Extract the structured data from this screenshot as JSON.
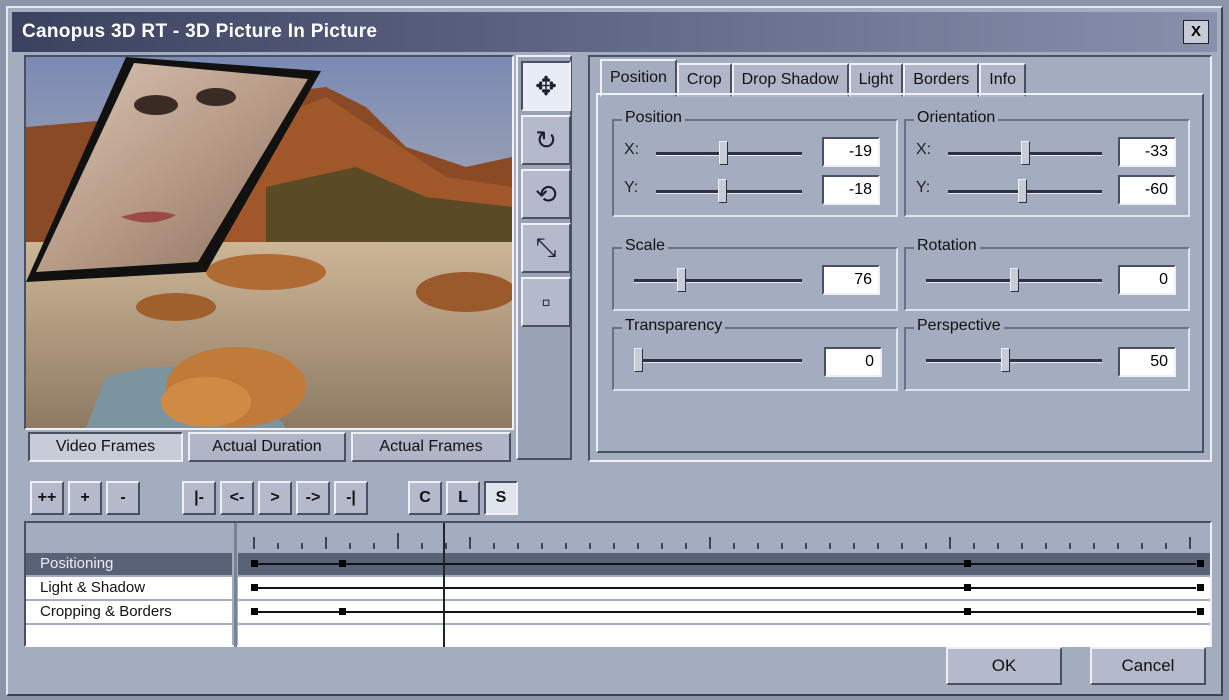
{
  "window": {
    "title": "Canopus 3D RT - 3D Picture In Picture",
    "close_label": "X"
  },
  "tools": [
    {
      "icon": "move-arrows-icon",
      "glyph": "✥"
    },
    {
      "icon": "rotate-3d-icon",
      "glyph": "↻"
    },
    {
      "icon": "rotate-2d-icon",
      "glyph": "⟲"
    },
    {
      "icon": "scale-icon",
      "glyph": "⤡"
    },
    {
      "icon": "blank-square-icon",
      "glyph": "▫"
    }
  ],
  "frame_modes": [
    "Video Frames",
    "Actual Duration",
    "Actual Frames"
  ],
  "tabs": [
    "Position",
    "Crop",
    "Drop Shadow",
    "Light",
    "Borders",
    "Info"
  ],
  "groups": {
    "position": {
      "label": "Position",
      "x_label": "X:",
      "y_label": "Y:",
      "x_value": "-19",
      "y_value": "-18",
      "x_level": 0.46,
      "y_level": 0.45
    },
    "orientation": {
      "label": "Orientation",
      "x_label": "X:",
      "y_label": "Y:",
      "x_value": "-33",
      "y_value": "-60",
      "x_level": 0.5,
      "y_level": 0.48
    },
    "scale": {
      "label": "Scale",
      "value": "76",
      "level": 0.27
    },
    "rotation": {
      "label": "Rotation",
      "value": "0",
      "level": 0.5
    },
    "transparency": {
      "label": "Transparency",
      "value": "0",
      "level": 0.0
    },
    "perspective": {
      "label": "Perspective",
      "value": "50",
      "level": 0.45
    }
  },
  "keyframe_toolbar": [
    "++",
    "+",
    "-"
  ],
  "transport": [
    "|-",
    "<-",
    ">",
    "->",
    "-|"
  ],
  "copy_buttons": [
    "C",
    "L",
    "S"
  ],
  "tracks": [
    {
      "label": "Positioning",
      "keyframes": [
        0.0,
        0.093,
        0.754,
        1.0
      ]
    },
    {
      "label": "Light & Shadow",
      "keyframes": [
        0.0,
        0.754,
        1.0
      ]
    },
    {
      "label": "Cropping & Borders",
      "keyframes": [
        0.0,
        0.093,
        0.754,
        1.0
      ]
    }
  ],
  "playhead": 0.2,
  "buttons": {
    "ok": "OK",
    "cancel": "Cancel"
  }
}
